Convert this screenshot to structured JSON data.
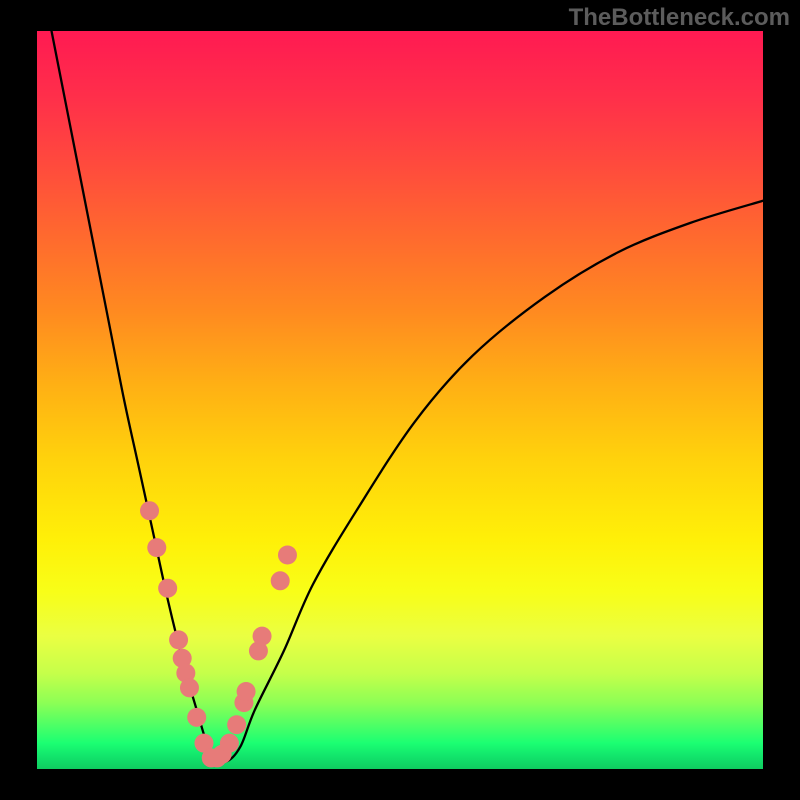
{
  "watermark": "TheBottleneck.com",
  "colors": {
    "frame": "#000000",
    "gradient_top": "#ff1a52",
    "gradient_mid": "#ffd20c",
    "gradient_bottom": "#0fcc60",
    "curve": "#000000",
    "beads": "#e77b79"
  },
  "chart_data": {
    "type": "line",
    "title": "",
    "xlabel": "",
    "ylabel": "",
    "xlim": [
      0,
      100
    ],
    "ylim": [
      0,
      100
    ],
    "grid": false,
    "legend": false,
    "annotation": "background gradient: red (top, high bottleneck) → green (bottom, good match); black V-curve dips to ~0 near x≈24",
    "series": [
      {
        "name": "bottleneck-curve",
        "x": [
          2,
          4,
          6,
          8,
          10,
          12,
          14,
          16,
          18,
          20,
          22,
          24,
          26,
          28,
          30,
          34,
          38,
          44,
          52,
          60,
          70,
          80,
          90,
          100
        ],
        "y": [
          100,
          90,
          80,
          70,
          60,
          50,
          41,
          32,
          23,
          15,
          8,
          2,
          1,
          3,
          8,
          16,
          25,
          35,
          47,
          56,
          64,
          70,
          74,
          77
        ]
      }
    ],
    "beads": {
      "name": "highlighted-points",
      "notes": "salmon dots clustered along the bottom of the V",
      "x": [
        15.5,
        16.5,
        18.0,
        19.5,
        20.0,
        20.5,
        21.0,
        22.0,
        23.0,
        24.0,
        24.8,
        25.5,
        26.5,
        27.5,
        28.5,
        28.8,
        30.5,
        31.0,
        33.5,
        34.5
      ],
      "y": [
        35.0,
        30.0,
        24.5,
        17.5,
        15.0,
        13.0,
        11.0,
        7.0,
        3.5,
        1.5,
        1.5,
        2.0,
        3.5,
        6.0,
        9.0,
        10.5,
        16.0,
        18.0,
        25.5,
        29.0
      ]
    }
  }
}
